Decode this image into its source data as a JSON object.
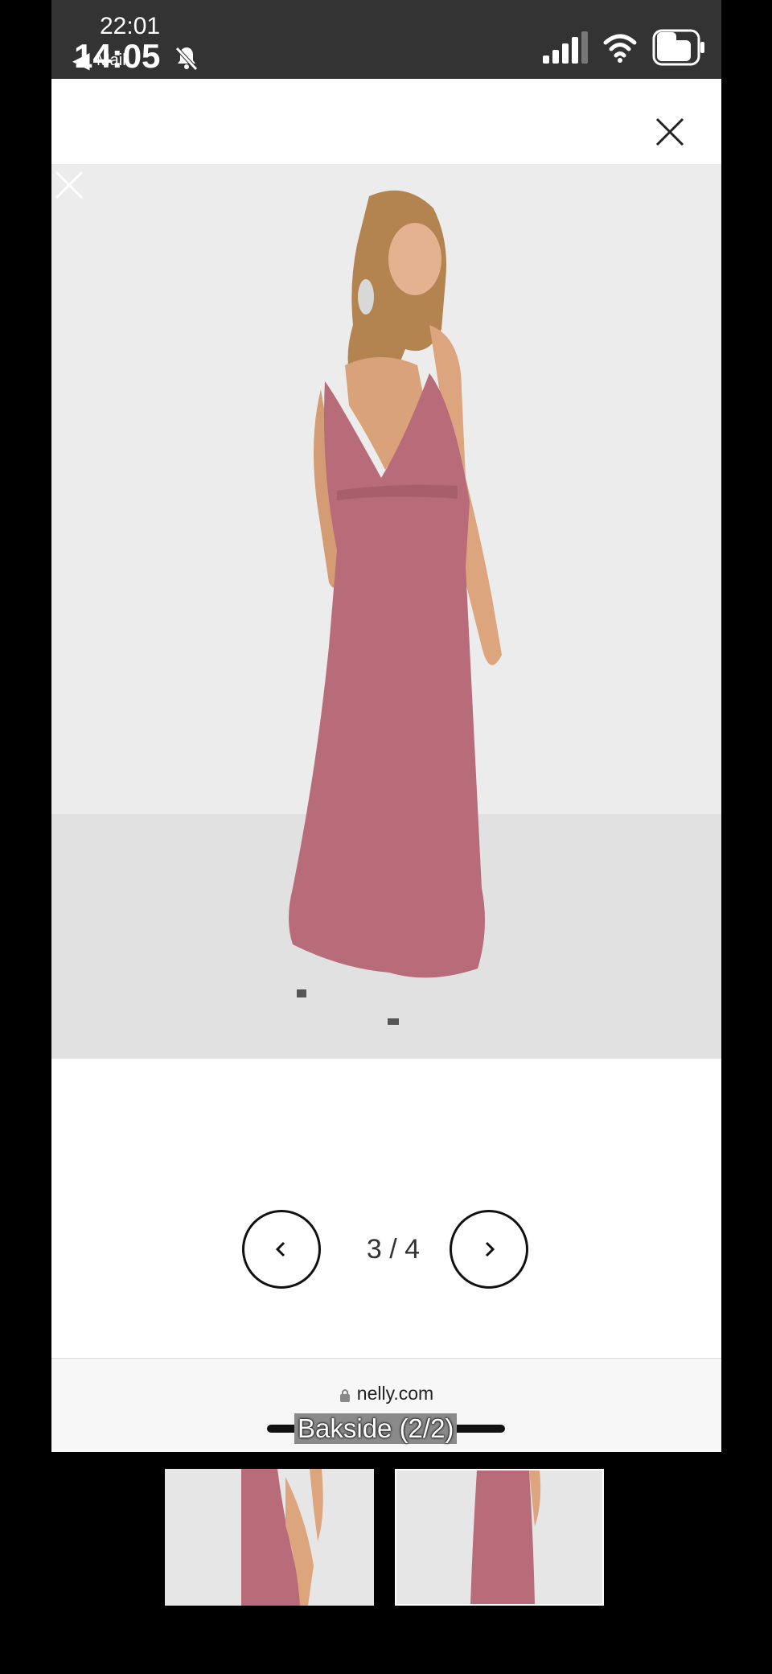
{
  "status_bar": {
    "time_top": "22:01",
    "time": "14:05",
    "back_label": "Mail"
  },
  "pager": {
    "counter": "3 / 4"
  },
  "browser": {
    "url": "nelly.com"
  },
  "caption": "Bakside (2/2)",
  "colors": {
    "dress": "#b86b78",
    "background": "#ececec",
    "status_bar": "#333333"
  }
}
